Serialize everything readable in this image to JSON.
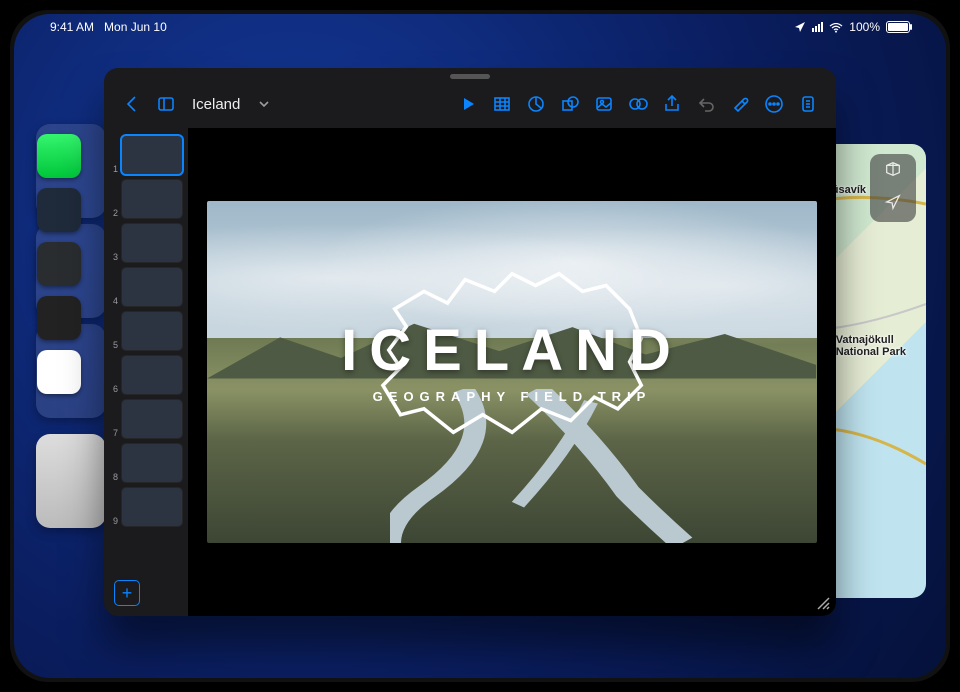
{
  "status": {
    "time": "9:41 AM",
    "date": "Mon Jun 10",
    "battery_pct": "100%"
  },
  "maps": {
    "label_husavik": "Húsavík",
    "label_park": "Vatnajökull\nNational Park"
  },
  "keynote": {
    "doc_name": "Iceland",
    "icons": {
      "back": "back-icon",
      "sidebar": "sidebar-toggle-icon",
      "chevron": "chevron-down-icon",
      "play": "play-icon",
      "table": "table-icon",
      "chart": "chart-icon",
      "shape": "shape-icon",
      "media": "media-icon",
      "comment": "comment-icon",
      "share": "share-icon",
      "undo": "undo-icon",
      "brush": "format-brush-icon",
      "more": "more-icon",
      "document": "document-options-icon",
      "add_slide": "add-slide-icon"
    },
    "slides": [
      {
        "n": "1"
      },
      {
        "n": "2"
      },
      {
        "n": "3"
      },
      {
        "n": "4"
      },
      {
        "n": "5"
      },
      {
        "n": "6"
      },
      {
        "n": "7"
      },
      {
        "n": "8"
      },
      {
        "n": "9"
      }
    ],
    "slide": {
      "title": "ICELAND",
      "subtitle": "GEOGRAPHY FIELD TRIP"
    }
  }
}
